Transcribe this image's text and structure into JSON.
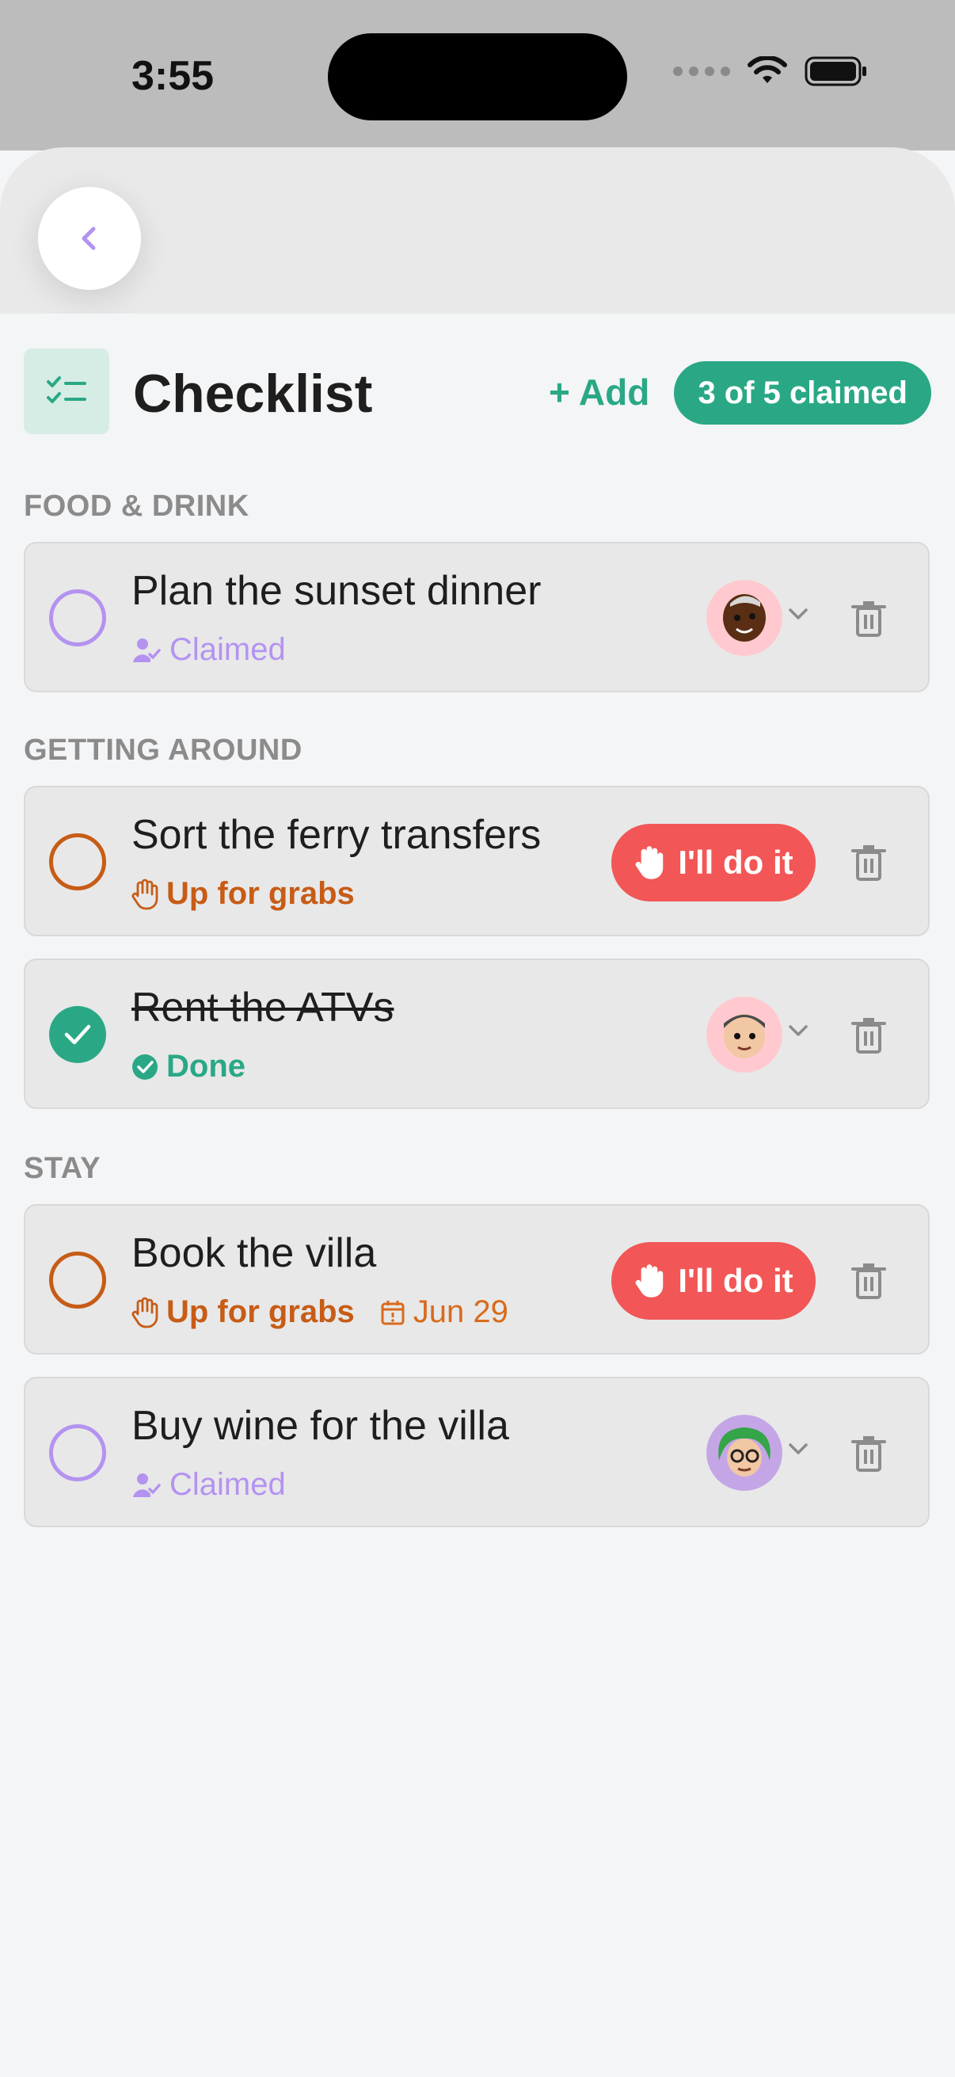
{
  "status_bar": {
    "time": "3:55"
  },
  "header": {
    "title": "Checklist",
    "add_label": "+ Add",
    "claimed_summary": "3 of 5 claimed"
  },
  "colors": {
    "accent_green": "#2aa886",
    "claimed_purple": "#b493f0",
    "grabs_orange": "#c75c16",
    "doit_red": "#f25656"
  },
  "sections": [
    {
      "label": "FOOD & DRINK",
      "items": [
        {
          "title": "Plan the sunset dinner",
          "status": "Claimed",
          "state": "claimed",
          "avatar": "avatar-dark-skin-white-hair"
        }
      ]
    },
    {
      "label": "GETTING AROUND",
      "items": [
        {
          "title": "Sort the ferry transfers",
          "status": "Up for grabs",
          "state": "open",
          "action": "I'll do it"
        },
        {
          "title": "Rent the ATVs",
          "status": "Done",
          "state": "done",
          "avatar": "avatar-light-skin-dark-hair"
        }
      ]
    },
    {
      "label": "STAY",
      "items": [
        {
          "title": "Book the villa",
          "status": "Up for grabs",
          "state": "open",
          "action": "I'll do it",
          "due": "Jun 29"
        },
        {
          "title": "Buy wine for the villa",
          "status": "Claimed",
          "state": "claimed",
          "avatar": "avatar-green-hair-glasses"
        }
      ]
    }
  ]
}
